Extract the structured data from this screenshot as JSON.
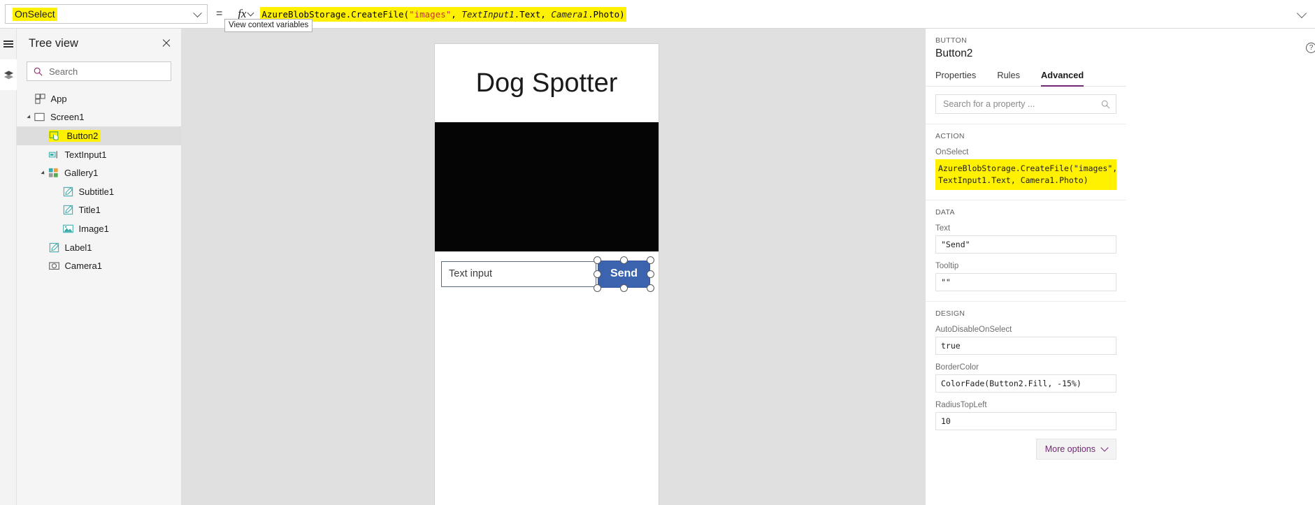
{
  "formula_bar": {
    "property_value": "OnSelect",
    "equals": "=",
    "fx_label": "fx",
    "tooltip": "View context variables",
    "formula_parts": [
      {
        "text": "AzureBlobStorage.CreateFile(",
        "kind": "fn"
      },
      {
        "text": "\"images\"",
        "kind": "str"
      },
      {
        "text": ", ",
        "kind": "fn"
      },
      {
        "text": "TextInput1",
        "kind": "ctl"
      },
      {
        "text": ".Text, ",
        "kind": "fn"
      },
      {
        "text": "Camera1",
        "kind": "ctl"
      },
      {
        "text": ".Photo)",
        "kind": "fn"
      }
    ],
    "formula_full": "AzureBlobStorage.CreateFile(\"images\", TextInput1.Text, Camera1.Photo)"
  },
  "rail": {
    "items": [
      {
        "name": "menu",
        "icon": "hamburger-icon"
      },
      {
        "name": "tree-view",
        "icon": "layers-icon"
      }
    ]
  },
  "tree_view": {
    "title": "Tree view",
    "search_placeholder": "Search",
    "items": [
      {
        "label": "App",
        "icon": "app-icon",
        "indent": 0,
        "expander": "none",
        "selected": false,
        "highlighted": false
      },
      {
        "label": "Screen1",
        "icon": "screen-icon",
        "indent": 0,
        "expander": "expanded",
        "selected": false,
        "highlighted": false
      },
      {
        "label": "Button2",
        "icon": "button-icon",
        "indent": 1,
        "expander": "none",
        "selected": true,
        "highlighted": true
      },
      {
        "label": "TextInput1",
        "icon": "textinput-icon",
        "indent": 1,
        "expander": "none",
        "selected": false,
        "highlighted": false
      },
      {
        "label": "Gallery1",
        "icon": "gallery-icon",
        "indent": 1,
        "expander": "expanded",
        "selected": false,
        "highlighted": false
      },
      {
        "label": "Subtitle1",
        "icon": "label-icon",
        "indent": 2,
        "expander": "none",
        "selected": false,
        "highlighted": false
      },
      {
        "label": "Title1",
        "icon": "label-icon",
        "indent": 2,
        "expander": "none",
        "selected": false,
        "highlighted": false
      },
      {
        "label": "Image1",
        "icon": "image-icon",
        "indent": 2,
        "expander": "none",
        "selected": false,
        "highlighted": false
      },
      {
        "label": "Label1",
        "icon": "label-icon",
        "indent": 1,
        "expander": "none",
        "selected": false,
        "highlighted": false
      },
      {
        "label": "Camera1",
        "icon": "camera-icon",
        "indent": 1,
        "expander": "none",
        "selected": false,
        "highlighted": false
      }
    ]
  },
  "canvas": {
    "app_title": "Dog Spotter",
    "camera_preview": "black",
    "text_input_value": "Text input",
    "send_button_label": "Send",
    "send_button_color": "#3c63ad",
    "selected_control": "Button2"
  },
  "properties_panel": {
    "kind": "BUTTON",
    "control_name": "Button2",
    "help_icon": "?",
    "tabs": [
      {
        "label": "Properties",
        "active": false
      },
      {
        "label": "Rules",
        "active": false
      },
      {
        "label": "Advanced",
        "active": true
      }
    ],
    "search_placeholder": "Search for a property ...",
    "sections": [
      {
        "title": "ACTION",
        "fields": [
          {
            "label": "OnSelect",
            "value": "AzureBlobStorage.CreateFile(\"images\", TextInput1.Text, Camera1.Photo)",
            "highlighted": true
          }
        ]
      },
      {
        "title": "DATA",
        "fields": [
          {
            "label": "Text",
            "value": "\"Send\"",
            "highlighted": false
          },
          {
            "label": "Tooltip",
            "value": "\"\"",
            "highlighted": false
          }
        ]
      },
      {
        "title": "DESIGN",
        "fields": [
          {
            "label": "AutoDisableOnSelect",
            "value": "true",
            "highlighted": false
          },
          {
            "label": "BorderColor",
            "value": "ColorFade(Button2.Fill, -15%)",
            "highlighted": false
          },
          {
            "label": "RadiusTopLeft",
            "value": "10",
            "highlighted": false
          }
        ]
      }
    ],
    "more_options_label": "More options"
  },
  "colors": {
    "accent_purple": "#742774",
    "highlight_yellow": "#fff100",
    "button_blue": "#3c63ad",
    "canvas_gray": "#e0e0e0"
  }
}
